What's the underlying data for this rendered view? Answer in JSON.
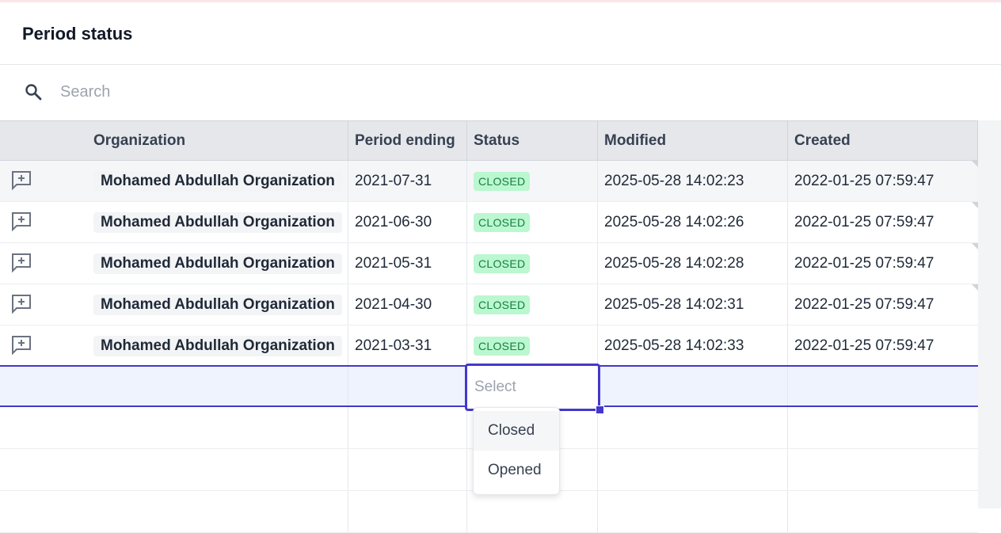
{
  "header": {
    "title": "Period status"
  },
  "search": {
    "placeholder": "Search",
    "value": ""
  },
  "table": {
    "columns": [
      "",
      "Organization",
      "Period ending",
      "Status",
      "Modified",
      "Created"
    ],
    "rows": [
      {
        "organization": "Mohamed Abdullah Organization",
        "period_ending": "2021-07-31",
        "status": "CLOSED",
        "modified": "2025-05-28 14:02:23",
        "created": "2022-01-25 07:59:47"
      },
      {
        "organization": "Mohamed Abdullah Organization",
        "period_ending": "2021-06-30",
        "status": "CLOSED",
        "modified": "2025-05-28 14:02:26",
        "created": "2022-01-25 07:59:47"
      },
      {
        "organization": "Mohamed Abdullah Organization",
        "period_ending": "2021-05-31",
        "status": "CLOSED",
        "modified": "2025-05-28 14:02:28",
        "created": "2022-01-25 07:59:47"
      },
      {
        "organization": "Mohamed Abdullah Organization",
        "period_ending": "2021-04-30",
        "status": "CLOSED",
        "modified": "2025-05-28 14:02:31",
        "created": "2022-01-25 07:59:47"
      },
      {
        "organization": "Mohamed Abdullah Organization",
        "period_ending": "2021-03-31",
        "status": "CLOSED",
        "modified": "2025-05-28 14:02:33",
        "created": "2022-01-25 07:59:47"
      }
    ]
  },
  "editor": {
    "placeholder": "Select"
  },
  "status_menu": {
    "options": [
      "Closed",
      "Opened"
    ]
  },
  "icons": {
    "search": "search-icon",
    "add_comment": "add-comment-icon"
  },
  "colors": {
    "accent": "#4338ca",
    "badge_bg": "#bbf7d0",
    "badge_text": "#15803d"
  }
}
